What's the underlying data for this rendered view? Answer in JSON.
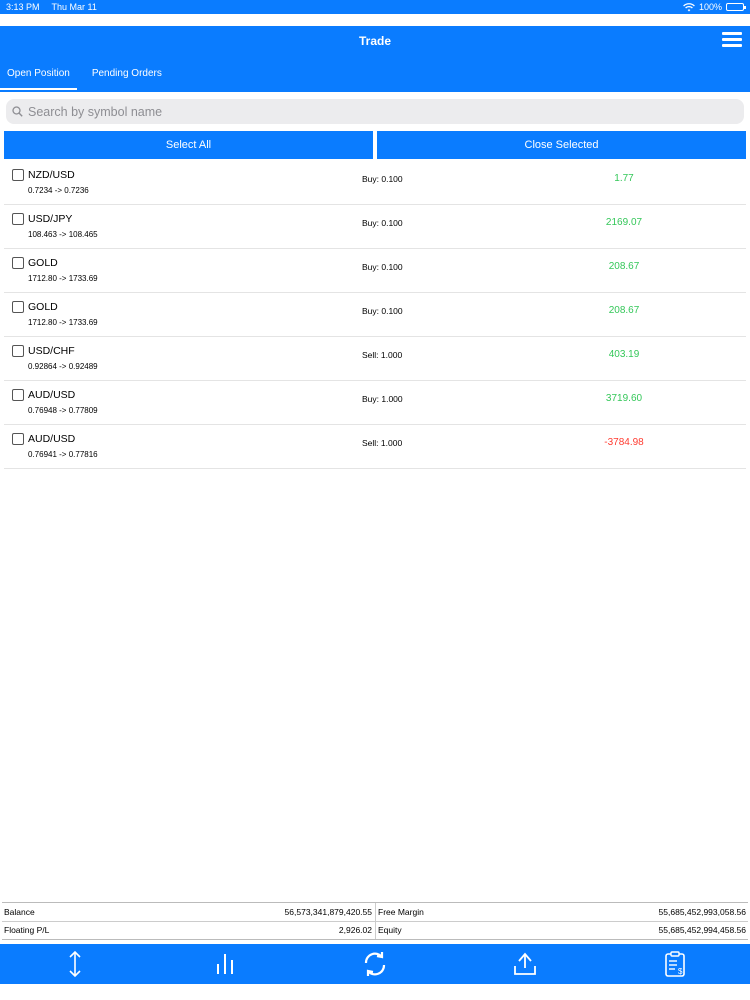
{
  "status_bar": {
    "time": "3:13 PM",
    "date": "Thu Mar 11",
    "battery": "100%",
    "wifi_icon": "wifi-icon"
  },
  "nav": {
    "title": "Trade",
    "menu_icon": "hamburger-menu-icon"
  },
  "tabs": [
    {
      "label": "Open Position",
      "active": true
    },
    {
      "label": "Pending Orders",
      "active": false
    }
  ],
  "search": {
    "placeholder": "Search by symbol name",
    "icon": "search-icon"
  },
  "actions": {
    "select_all": "Select All",
    "close_selected": "Close Selected"
  },
  "positions": [
    {
      "symbol": "NZD/USD",
      "rate": "0.7234 -> 0.7236",
      "order": "Buy: 0.100",
      "pl": "1.77",
      "status": "positive"
    },
    {
      "symbol": "USD/JPY",
      "rate": "108.463 -> 108.465",
      "order": "Buy: 0.100",
      "pl": "2169.07",
      "status": "positive"
    },
    {
      "symbol": "GOLD",
      "rate": "1712.80 -> 1733.69",
      "order": "Buy: 0.100",
      "pl": "208.67",
      "status": "positive"
    },
    {
      "symbol": "GOLD",
      "rate": "1712.80 -> 1733.69",
      "order": "Buy: 0.100",
      "pl": "208.67",
      "status": "positive"
    },
    {
      "symbol": "USD/CHF",
      "rate": "0.92864 -> 0.92489",
      "order": "Sell: 1.000",
      "pl": "403.19",
      "status": "positive"
    },
    {
      "symbol": "AUD/USD",
      "rate": "0.76948 -> 0.77809",
      "order": "Buy: 1.000",
      "pl": "3719.60",
      "status": "positive"
    },
    {
      "symbol": "AUD/USD",
      "rate": "0.76941 -> 0.77816",
      "order": "Sell: 1.000",
      "pl": "-3784.98",
      "status": "negative"
    }
  ],
  "summary": {
    "balance_label": "Balance",
    "balance": "56,573,341,879,420.55",
    "free_margin_label": "Free Margin",
    "free_margin": "55,685,452,993,058.56",
    "floating_label": "Floating P/L",
    "floating": "2,926.02",
    "equity_label": "Equity",
    "equity": "55,685,452,994,458.56"
  },
  "tab_bar": [
    "updown-arrows-icon",
    "bar-chart-icon",
    "refresh-icon",
    "upload-icon",
    "clipboard-dollar-icon"
  ],
  "colors": {
    "accent": "#0a7cff",
    "positive": "#34c759",
    "negative": "#ff3b30"
  }
}
